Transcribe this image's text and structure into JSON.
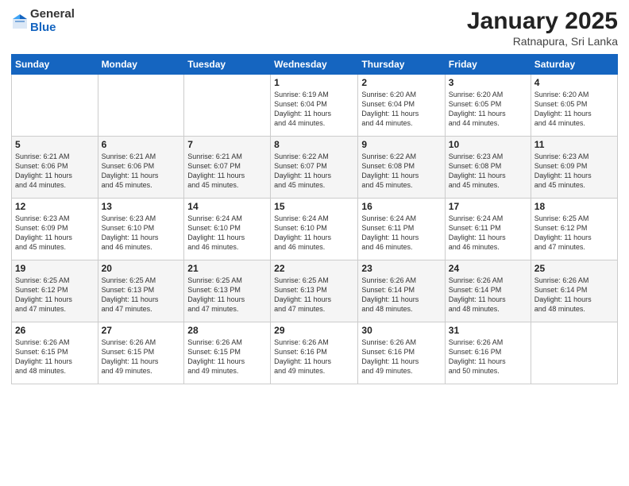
{
  "logo": {
    "general": "General",
    "blue": "Blue"
  },
  "title": {
    "month": "January 2025",
    "location": "Ratnapura, Sri Lanka"
  },
  "weekdays": [
    "Sunday",
    "Monday",
    "Tuesday",
    "Wednesday",
    "Thursday",
    "Friday",
    "Saturday"
  ],
  "weeks": [
    [
      {
        "day": "",
        "info": ""
      },
      {
        "day": "",
        "info": ""
      },
      {
        "day": "",
        "info": ""
      },
      {
        "day": "1",
        "info": "Sunrise: 6:19 AM\nSunset: 6:04 PM\nDaylight: 11 hours\nand 44 minutes."
      },
      {
        "day": "2",
        "info": "Sunrise: 6:20 AM\nSunset: 6:04 PM\nDaylight: 11 hours\nand 44 minutes."
      },
      {
        "day": "3",
        "info": "Sunrise: 6:20 AM\nSunset: 6:05 PM\nDaylight: 11 hours\nand 44 minutes."
      },
      {
        "day": "4",
        "info": "Sunrise: 6:20 AM\nSunset: 6:05 PM\nDaylight: 11 hours\nand 44 minutes."
      }
    ],
    [
      {
        "day": "5",
        "info": "Sunrise: 6:21 AM\nSunset: 6:06 PM\nDaylight: 11 hours\nand 44 minutes."
      },
      {
        "day": "6",
        "info": "Sunrise: 6:21 AM\nSunset: 6:06 PM\nDaylight: 11 hours\nand 45 minutes."
      },
      {
        "day": "7",
        "info": "Sunrise: 6:21 AM\nSunset: 6:07 PM\nDaylight: 11 hours\nand 45 minutes."
      },
      {
        "day": "8",
        "info": "Sunrise: 6:22 AM\nSunset: 6:07 PM\nDaylight: 11 hours\nand 45 minutes."
      },
      {
        "day": "9",
        "info": "Sunrise: 6:22 AM\nSunset: 6:08 PM\nDaylight: 11 hours\nand 45 minutes."
      },
      {
        "day": "10",
        "info": "Sunrise: 6:23 AM\nSunset: 6:08 PM\nDaylight: 11 hours\nand 45 minutes."
      },
      {
        "day": "11",
        "info": "Sunrise: 6:23 AM\nSunset: 6:09 PM\nDaylight: 11 hours\nand 45 minutes."
      }
    ],
    [
      {
        "day": "12",
        "info": "Sunrise: 6:23 AM\nSunset: 6:09 PM\nDaylight: 11 hours\nand 45 minutes."
      },
      {
        "day": "13",
        "info": "Sunrise: 6:23 AM\nSunset: 6:10 PM\nDaylight: 11 hours\nand 46 minutes."
      },
      {
        "day": "14",
        "info": "Sunrise: 6:24 AM\nSunset: 6:10 PM\nDaylight: 11 hours\nand 46 minutes."
      },
      {
        "day": "15",
        "info": "Sunrise: 6:24 AM\nSunset: 6:10 PM\nDaylight: 11 hours\nand 46 minutes."
      },
      {
        "day": "16",
        "info": "Sunrise: 6:24 AM\nSunset: 6:11 PM\nDaylight: 11 hours\nand 46 minutes."
      },
      {
        "day": "17",
        "info": "Sunrise: 6:24 AM\nSunset: 6:11 PM\nDaylight: 11 hours\nand 46 minutes."
      },
      {
        "day": "18",
        "info": "Sunrise: 6:25 AM\nSunset: 6:12 PM\nDaylight: 11 hours\nand 47 minutes."
      }
    ],
    [
      {
        "day": "19",
        "info": "Sunrise: 6:25 AM\nSunset: 6:12 PM\nDaylight: 11 hours\nand 47 minutes."
      },
      {
        "day": "20",
        "info": "Sunrise: 6:25 AM\nSunset: 6:13 PM\nDaylight: 11 hours\nand 47 minutes."
      },
      {
        "day": "21",
        "info": "Sunrise: 6:25 AM\nSunset: 6:13 PM\nDaylight: 11 hours\nand 47 minutes."
      },
      {
        "day": "22",
        "info": "Sunrise: 6:25 AM\nSunset: 6:13 PM\nDaylight: 11 hours\nand 47 minutes."
      },
      {
        "day": "23",
        "info": "Sunrise: 6:26 AM\nSunset: 6:14 PM\nDaylight: 11 hours\nand 48 minutes."
      },
      {
        "day": "24",
        "info": "Sunrise: 6:26 AM\nSunset: 6:14 PM\nDaylight: 11 hours\nand 48 minutes."
      },
      {
        "day": "25",
        "info": "Sunrise: 6:26 AM\nSunset: 6:14 PM\nDaylight: 11 hours\nand 48 minutes."
      }
    ],
    [
      {
        "day": "26",
        "info": "Sunrise: 6:26 AM\nSunset: 6:15 PM\nDaylight: 11 hours\nand 48 minutes."
      },
      {
        "day": "27",
        "info": "Sunrise: 6:26 AM\nSunset: 6:15 PM\nDaylight: 11 hours\nand 49 minutes."
      },
      {
        "day": "28",
        "info": "Sunrise: 6:26 AM\nSunset: 6:15 PM\nDaylight: 11 hours\nand 49 minutes."
      },
      {
        "day": "29",
        "info": "Sunrise: 6:26 AM\nSunset: 6:16 PM\nDaylight: 11 hours\nand 49 minutes."
      },
      {
        "day": "30",
        "info": "Sunrise: 6:26 AM\nSunset: 6:16 PM\nDaylight: 11 hours\nand 49 minutes."
      },
      {
        "day": "31",
        "info": "Sunrise: 6:26 AM\nSunset: 6:16 PM\nDaylight: 11 hours\nand 50 minutes."
      },
      {
        "day": "",
        "info": ""
      }
    ]
  ]
}
